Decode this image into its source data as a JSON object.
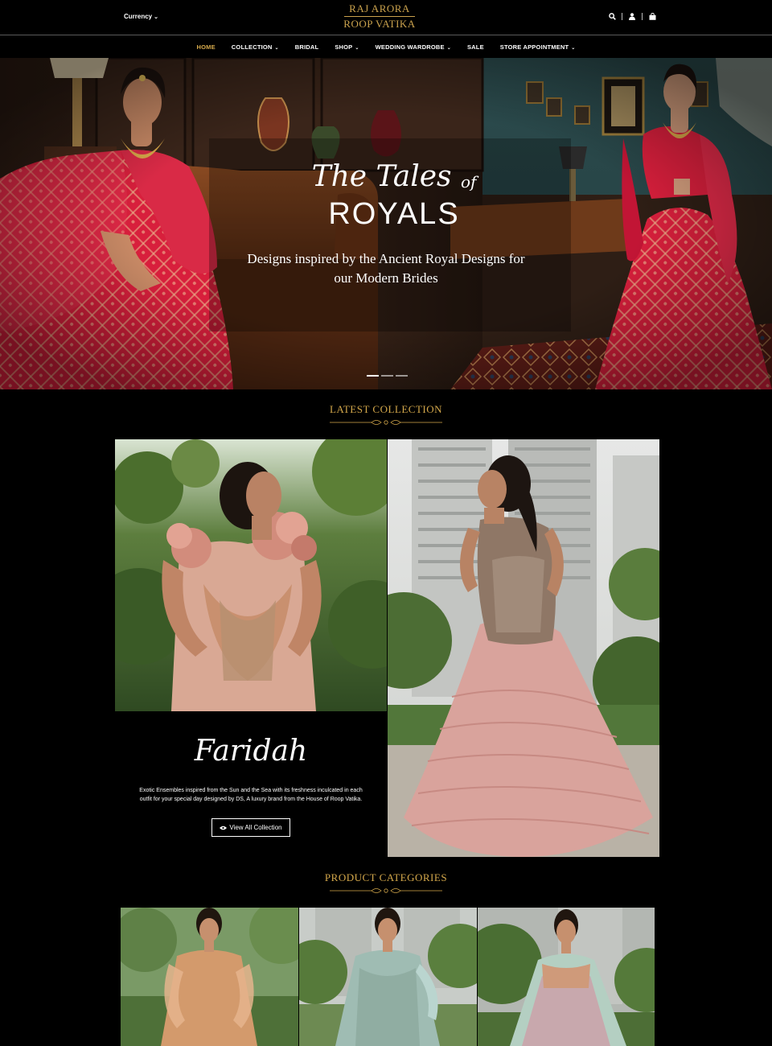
{
  "header": {
    "currency_label": "Currency",
    "logo_line1": "RAJ ARORA",
    "logo_line2": "ROOP VATIKA",
    "icons": [
      "search-icon",
      "user-icon",
      "shopping-bag-icon"
    ]
  },
  "nav": {
    "items": [
      {
        "label": "HOME",
        "has_dropdown": false,
        "active": true
      },
      {
        "label": "COLLECTION",
        "has_dropdown": true
      },
      {
        "label": "BRIDAL",
        "has_dropdown": false
      },
      {
        "label": "SHOP",
        "has_dropdown": true
      },
      {
        "label": "WEDDING WARDROBE",
        "has_dropdown": true
      },
      {
        "label": "SALE",
        "has_dropdown": false
      },
      {
        "label": "STORE APPOINTMENT",
        "has_dropdown": true
      }
    ]
  },
  "hero": {
    "script_title": "The Tales",
    "script_of": "of",
    "title": "ROYALS",
    "subtitle_line1": "Designs inspired by the Ancient Royal Designs for",
    "subtitle_line2": "our Modern Brides",
    "slides_count": 3,
    "active_slide": 1
  },
  "latest_collection": {
    "heading": "LATEST COLLECTION",
    "collection_name": "Faridah",
    "description": "Exotic Ensembles inspired from the Sun and the Sea with its freshness inculcated in each outfit for your special day designed by DS, A luxury brand from the House of Roop Vatika.",
    "button_label": "View All Collection",
    "button_icon": "eye-icon"
  },
  "product_categories": {
    "heading": "PRODUCT CATEGORIES"
  },
  "colors": {
    "gold": "#d4a84b",
    "background": "#000000",
    "bridal_red": "#d81f3c",
    "blush_pink": "#d9a39c"
  }
}
